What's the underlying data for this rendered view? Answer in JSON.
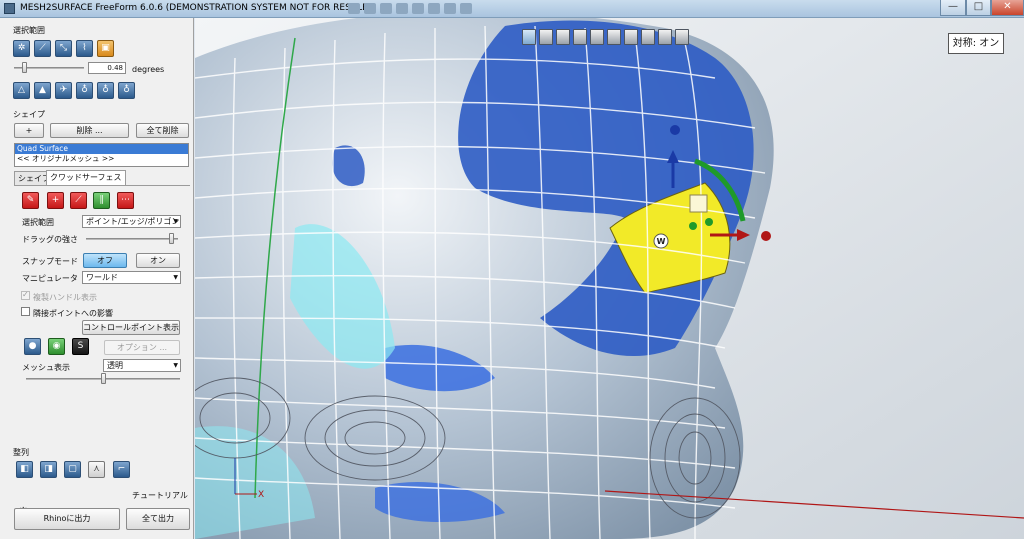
{
  "window": {
    "title": "MESH2SURFACE FreeForm 6.0.6 (DEMONSTRATION SYSTEM NOT FOR RESALE)",
    "minimize": "—",
    "maximize": "□",
    "close": "✕"
  },
  "selection": {
    "heading": "選択範囲",
    "angle_value": "0.48",
    "angle_unit": "degrees"
  },
  "shape": {
    "heading": "シェイプ",
    "add_label": "+",
    "delete_label": "削除 ...",
    "delete_all_label": "全て削除",
    "items": [
      "Quad Surface",
      "<< オリジナルメッシュ >>"
    ],
    "selected_index": 0
  },
  "tabs": [
    "シェイプ",
    "クワッドサーフェス"
  ],
  "active_tab": 1,
  "quad": {
    "selection_label": "選択範囲",
    "selection_value": "ポイント/エッジ/ポリゴン",
    "drag_strength_label": "ドラッグの強さ",
    "drag_strength": 0.95,
    "snap_label": "スナップモード",
    "snap_off": "オフ",
    "snap_on": "オン",
    "snap_state": "off",
    "manipulator_label": "マニピュレータ",
    "manipulator_value": "ワールド",
    "duplicate_handles_label": "複製ハンドル表示",
    "adjacent_points_label": "隣接ポイントへの影響",
    "control_points_button": "コントロールポイント表示",
    "options_button": "オプション ...",
    "mesh_display_label": "メッシュ表示",
    "mesh_display_value": "透明",
    "mesh_transparency": 0.5
  },
  "align": {
    "heading": "整列",
    "tutorial_label": "チュートリアル"
  },
  "export": {
    "rhino_button": "Rhinoに出力",
    "all_button": "全て出力"
  },
  "viewport": {
    "symmetry_label": "対称: オン",
    "selected_point_label": "W",
    "axis_x_label": "X"
  },
  "colors": {
    "accent_blue": "#2e5cc4",
    "selection_yellow": "#f2ea28",
    "manipulator_red": "#b01616",
    "manipulator_green": "#1f9a2a"
  }
}
